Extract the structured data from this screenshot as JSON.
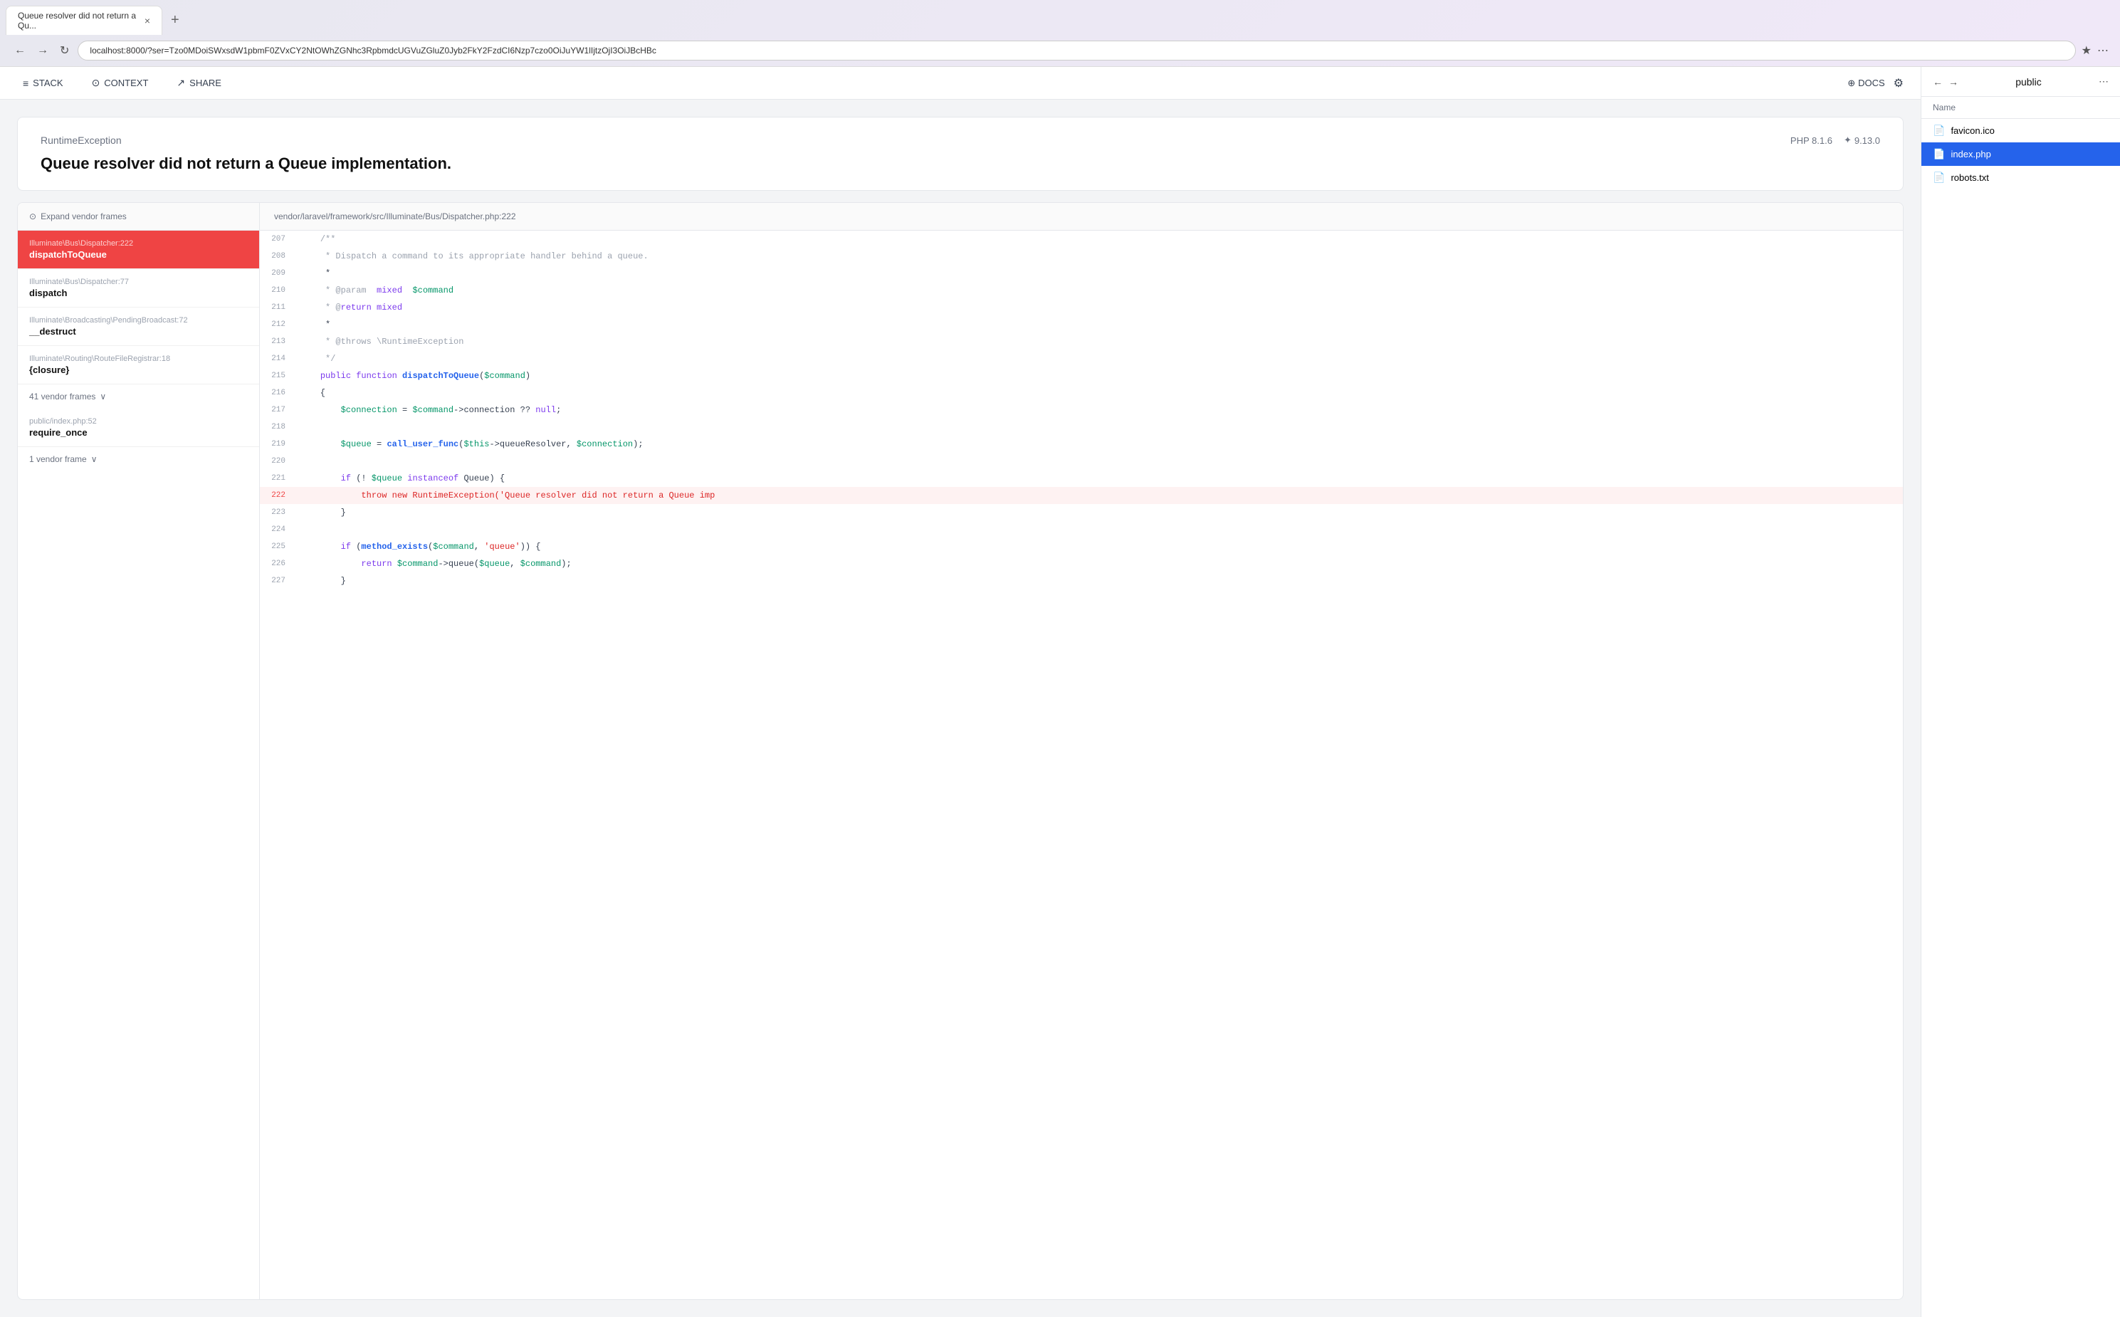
{
  "browser": {
    "tab_title": "Queue resolver did not return a Qu...",
    "tab_close": "×",
    "tab_new": "+",
    "url": "localhost:8000/?ser=Tzo0MDoiSWxsdW1pbmF0ZVxCY2NtOWhZGNhc3RpbmdcUGVuZGluZ0Jyb2FkY2FzdCI6Nzp7czo0OiJuYW1lIjtzOjI3OiJBcHBc",
    "nav_back": "←",
    "nav_forward": "→",
    "nav_reload": "↻"
  },
  "toolbar": {
    "stack_label": "STACK",
    "context_label": "CONTEXT",
    "share_label": "SHARE",
    "docs_label": "DOCS",
    "stack_icon": "≡",
    "context_icon": "⊙",
    "share_icon": "↗",
    "docs_icon": "⊕",
    "settings_icon": "⚙"
  },
  "error": {
    "exception_type": "RuntimeException",
    "message": "Queue resolver did not return a Queue implementation.",
    "php_version": "PHP 8.1.6",
    "ignition_version": "9.13.0"
  },
  "stack": {
    "expand_vendor_label": "Expand vendor frames",
    "frames": [
      {
        "path": "Illuminate\\Bus\\Dispatcher:222",
        "method": "dispatchToQueue",
        "active": true,
        "vendor": false
      },
      {
        "path": "Illuminate\\Bus\\Dispatcher:77",
        "method": "dispatch",
        "active": false,
        "vendor": false
      },
      {
        "path": "Illuminate\\Broadcasting\\PendingBroadcast:72",
        "method": "__destruct",
        "active": false,
        "vendor": false
      },
      {
        "path": "Illuminate\\Routing\\RouteFileRegistrar:18",
        "method": "{closure}",
        "active": false,
        "vendor": false
      },
      {
        "path": "41 vendor frames",
        "method": "",
        "active": false,
        "vendor": true,
        "vendor_count": true
      },
      {
        "path": "public/index.php:52",
        "method": "require_once",
        "active": false,
        "vendor": false
      },
      {
        "path": "1 vendor frame",
        "method": "",
        "active": false,
        "vendor": true,
        "vendor_count": true
      }
    ]
  },
  "code": {
    "file_path": "vendor/laravel/framework/src/Illuminate/Bus/Dispatcher.php:222",
    "lines": [
      {
        "num": 207,
        "content": "    /**",
        "highlighted": false
      },
      {
        "num": 208,
        "content": "     * Dispatch a command to its appropriate handler behind a queue.",
        "highlighted": false
      },
      {
        "num": 209,
        "content": "     *",
        "highlighted": false
      },
      {
        "num": 210,
        "content": "     * @param  mixed  $command",
        "highlighted": false
      },
      {
        "num": 211,
        "content": "     * @return mixed",
        "highlighted": false
      },
      {
        "num": 212,
        "content": "     *",
        "highlighted": false
      },
      {
        "num": 213,
        "content": "     * @throws \\RuntimeException",
        "highlighted": false
      },
      {
        "num": 214,
        "content": "     */",
        "highlighted": false
      },
      {
        "num": 215,
        "content": "    public function dispatchToQueue($command)",
        "highlighted": false
      },
      {
        "num": 216,
        "content": "    {",
        "highlighted": false
      },
      {
        "num": 217,
        "content": "        $connection = $command->connection ?? null;",
        "highlighted": false
      },
      {
        "num": 218,
        "content": "",
        "highlighted": false
      },
      {
        "num": 219,
        "content": "        $queue = call_user_func($this->queueResolver, $connection);",
        "highlighted": false
      },
      {
        "num": 220,
        "content": "",
        "highlighted": false
      },
      {
        "num": 221,
        "content": "        if (! $queue instanceof Queue) {",
        "highlighted": false
      },
      {
        "num": 222,
        "content": "            throw new RuntimeException('Queue resolver did not return a Queue imp",
        "highlighted": true
      },
      {
        "num": 223,
        "content": "        }",
        "highlighted": false
      },
      {
        "num": 224,
        "content": "",
        "highlighted": false
      },
      {
        "num": 225,
        "content": "        if (method_exists($command, 'queue')) {",
        "highlighted": false
      },
      {
        "num": 226,
        "content": "            return $command->queue($queue, $command);",
        "highlighted": false
      },
      {
        "num": 227,
        "content": "        }",
        "highlighted": false
      }
    ]
  },
  "file_browser": {
    "title": "public",
    "header_name": "Name",
    "files": [
      {
        "name": "favicon.ico",
        "selected": false,
        "icon": "📄"
      },
      {
        "name": "index.php",
        "selected": true,
        "icon": "📄"
      },
      {
        "name": "robots.txt",
        "selected": false,
        "icon": "📄"
      }
    ]
  }
}
